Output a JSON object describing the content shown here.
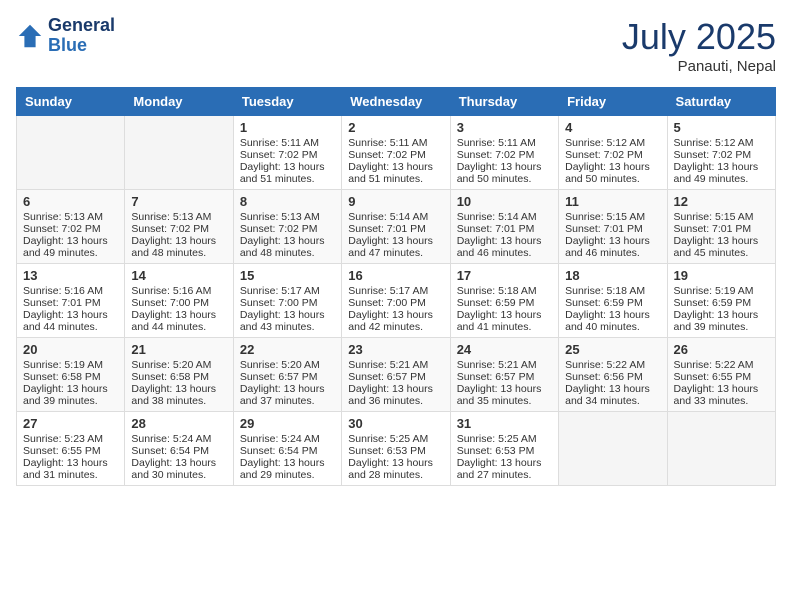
{
  "header": {
    "logo_line1": "General",
    "logo_line2": "Blue",
    "month": "July 2025",
    "location": "Panauti, Nepal"
  },
  "weekdays": [
    "Sunday",
    "Monday",
    "Tuesday",
    "Wednesday",
    "Thursday",
    "Friday",
    "Saturday"
  ],
  "weeks": [
    [
      {
        "day": "",
        "info": ""
      },
      {
        "day": "",
        "info": ""
      },
      {
        "day": "1",
        "info": "Sunrise: 5:11 AM\nSunset: 7:02 PM\nDaylight: 13 hours and 51 minutes."
      },
      {
        "day": "2",
        "info": "Sunrise: 5:11 AM\nSunset: 7:02 PM\nDaylight: 13 hours and 51 minutes."
      },
      {
        "day": "3",
        "info": "Sunrise: 5:11 AM\nSunset: 7:02 PM\nDaylight: 13 hours and 50 minutes."
      },
      {
        "day": "4",
        "info": "Sunrise: 5:12 AM\nSunset: 7:02 PM\nDaylight: 13 hours and 50 minutes."
      },
      {
        "day": "5",
        "info": "Sunrise: 5:12 AM\nSunset: 7:02 PM\nDaylight: 13 hours and 49 minutes."
      }
    ],
    [
      {
        "day": "6",
        "info": "Sunrise: 5:13 AM\nSunset: 7:02 PM\nDaylight: 13 hours and 49 minutes."
      },
      {
        "day": "7",
        "info": "Sunrise: 5:13 AM\nSunset: 7:02 PM\nDaylight: 13 hours and 48 minutes."
      },
      {
        "day": "8",
        "info": "Sunrise: 5:13 AM\nSunset: 7:02 PM\nDaylight: 13 hours and 48 minutes."
      },
      {
        "day": "9",
        "info": "Sunrise: 5:14 AM\nSunset: 7:01 PM\nDaylight: 13 hours and 47 minutes."
      },
      {
        "day": "10",
        "info": "Sunrise: 5:14 AM\nSunset: 7:01 PM\nDaylight: 13 hours and 46 minutes."
      },
      {
        "day": "11",
        "info": "Sunrise: 5:15 AM\nSunset: 7:01 PM\nDaylight: 13 hours and 46 minutes."
      },
      {
        "day": "12",
        "info": "Sunrise: 5:15 AM\nSunset: 7:01 PM\nDaylight: 13 hours and 45 minutes."
      }
    ],
    [
      {
        "day": "13",
        "info": "Sunrise: 5:16 AM\nSunset: 7:01 PM\nDaylight: 13 hours and 44 minutes."
      },
      {
        "day": "14",
        "info": "Sunrise: 5:16 AM\nSunset: 7:00 PM\nDaylight: 13 hours and 44 minutes."
      },
      {
        "day": "15",
        "info": "Sunrise: 5:17 AM\nSunset: 7:00 PM\nDaylight: 13 hours and 43 minutes."
      },
      {
        "day": "16",
        "info": "Sunrise: 5:17 AM\nSunset: 7:00 PM\nDaylight: 13 hours and 42 minutes."
      },
      {
        "day": "17",
        "info": "Sunrise: 5:18 AM\nSunset: 6:59 PM\nDaylight: 13 hours and 41 minutes."
      },
      {
        "day": "18",
        "info": "Sunrise: 5:18 AM\nSunset: 6:59 PM\nDaylight: 13 hours and 40 minutes."
      },
      {
        "day": "19",
        "info": "Sunrise: 5:19 AM\nSunset: 6:59 PM\nDaylight: 13 hours and 39 minutes."
      }
    ],
    [
      {
        "day": "20",
        "info": "Sunrise: 5:19 AM\nSunset: 6:58 PM\nDaylight: 13 hours and 39 minutes."
      },
      {
        "day": "21",
        "info": "Sunrise: 5:20 AM\nSunset: 6:58 PM\nDaylight: 13 hours and 38 minutes."
      },
      {
        "day": "22",
        "info": "Sunrise: 5:20 AM\nSunset: 6:57 PM\nDaylight: 13 hours and 37 minutes."
      },
      {
        "day": "23",
        "info": "Sunrise: 5:21 AM\nSunset: 6:57 PM\nDaylight: 13 hours and 36 minutes."
      },
      {
        "day": "24",
        "info": "Sunrise: 5:21 AM\nSunset: 6:57 PM\nDaylight: 13 hours and 35 minutes."
      },
      {
        "day": "25",
        "info": "Sunrise: 5:22 AM\nSunset: 6:56 PM\nDaylight: 13 hours and 34 minutes."
      },
      {
        "day": "26",
        "info": "Sunrise: 5:22 AM\nSunset: 6:55 PM\nDaylight: 13 hours and 33 minutes."
      }
    ],
    [
      {
        "day": "27",
        "info": "Sunrise: 5:23 AM\nSunset: 6:55 PM\nDaylight: 13 hours and 31 minutes."
      },
      {
        "day": "28",
        "info": "Sunrise: 5:24 AM\nSunset: 6:54 PM\nDaylight: 13 hours and 30 minutes."
      },
      {
        "day": "29",
        "info": "Sunrise: 5:24 AM\nSunset: 6:54 PM\nDaylight: 13 hours and 29 minutes."
      },
      {
        "day": "30",
        "info": "Sunrise: 5:25 AM\nSunset: 6:53 PM\nDaylight: 13 hours and 28 minutes."
      },
      {
        "day": "31",
        "info": "Sunrise: 5:25 AM\nSunset: 6:53 PM\nDaylight: 13 hours and 27 minutes."
      },
      {
        "day": "",
        "info": ""
      },
      {
        "day": "",
        "info": ""
      }
    ]
  ]
}
